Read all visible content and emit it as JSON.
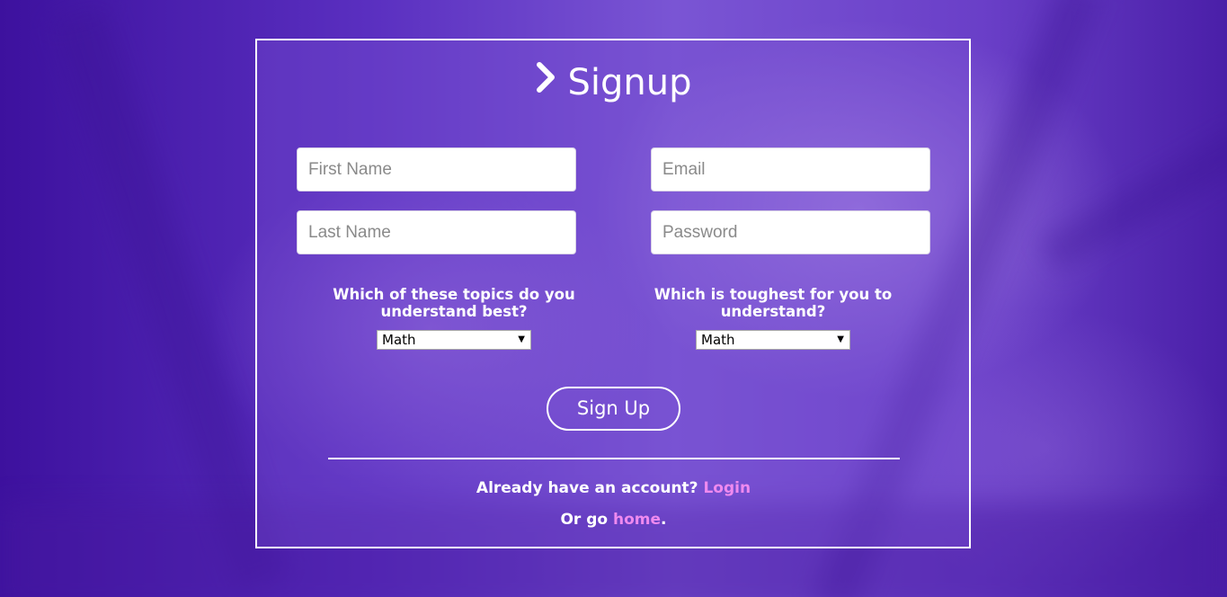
{
  "form": {
    "title": "Signup",
    "first_name_placeholder": "First Name",
    "last_name_placeholder": "Last Name",
    "email_placeholder": "Email",
    "password_placeholder": "Password",
    "question_best": "Which of these topics do you understand best?",
    "question_toughest": "Which is toughest for you to understand?",
    "best_selected": "Math",
    "toughest_selected": "Math",
    "submit_label": "Sign Up"
  },
  "footer": {
    "already_text": "Already have an account?",
    "login_link": "Login",
    "or_go_text": "Or go",
    "home_link": "home",
    "period": "."
  },
  "colors": {
    "link": "#ef8aef",
    "background": "#4a1fa8",
    "border": "#ffffff"
  },
  "icons": {
    "title_icon": "chevron-right-icon",
    "select_arrow": "caret-down-icon"
  }
}
